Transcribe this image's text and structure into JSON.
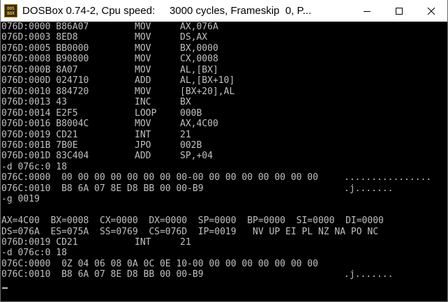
{
  "window": {
    "title": "DOSBox 0.74-2, Cpu speed:     3000 cycles, Frameskip  0, P...",
    "icon": {
      "name": "dosbox-icon",
      "text_top": "DOS",
      "text_bottom": "BOX"
    }
  },
  "colors": {
    "console_background": "#000000",
    "console_text": "#c0c0c0",
    "titlebar_background": "#ffffff"
  },
  "console": {
    "lines": [
      [
        "076D:0000 B86A07",
        "MOV",
        "AX,076A"
      ],
      [
        "076D:0003 8ED8",
        "MOV",
        "DS,AX"
      ],
      [
        "076D:0005 BB0000",
        "MOV",
        "BX,0000"
      ],
      [
        "076D:0008 B90800",
        "MOV",
        "CX,0008"
      ],
      [
        "076D:000B 8A07",
        "MOV",
        "AL,[BX]"
      ],
      [
        "076D:000D 024710",
        "ADD",
        "AL,[BX+10]"
      ],
      [
        "076D:0010 884720",
        "MOV",
        "[BX+20],AL"
      ],
      [
        "076D:0013 43",
        "INC",
        "BX"
      ],
      [
        "076D:0014 E2F5",
        "LOOP",
        "000B"
      ],
      [
        "076D:0016 B8004C",
        "MOV",
        "AX,4C00"
      ],
      [
        "076D:0019 CD21",
        "INT",
        "21"
      ],
      [
        "076D:001B 7B0E",
        "JPO",
        "002B"
      ],
      [
        "076D:001D 83C404",
        "ADD",
        "SP,+04"
      ],
      [
        "-d 076c:0 18"
      ],
      [
        "076C:0000  00 00 00 00 00 00 00 00-00 00 00 00 00 00 00 00",
        "................"
      ],
      [
        "076C:0010  B8 6A 07 8E D8 BB 00 00-B9",
        ".j......."
      ],
      [
        "-g 0019"
      ],
      [
        ""
      ],
      [
        "AX=4C00  BX=0008  CX=0000  DX=0000  SP=0000  BP=0000  SI=0000  DI=0000"
      ],
      [
        "DS=076A  ES=075A  SS=0769  CS=076D  IP=0019   NV UP EI PL NZ NA PO NC"
      ],
      [
        "076D:0019 CD21",
        "INT",
        "21"
      ],
      [
        "-d 076c:0 18"
      ],
      [
        "076C:0000  0Z 04 06 08 0A 0C 0E 10-00 00 00 00 00 00 00 00"
      ],
      [
        "076C:0010  B8 6A 07 8E D8 BB 00 00-B9",
        ".j......."
      ]
    ]
  }
}
